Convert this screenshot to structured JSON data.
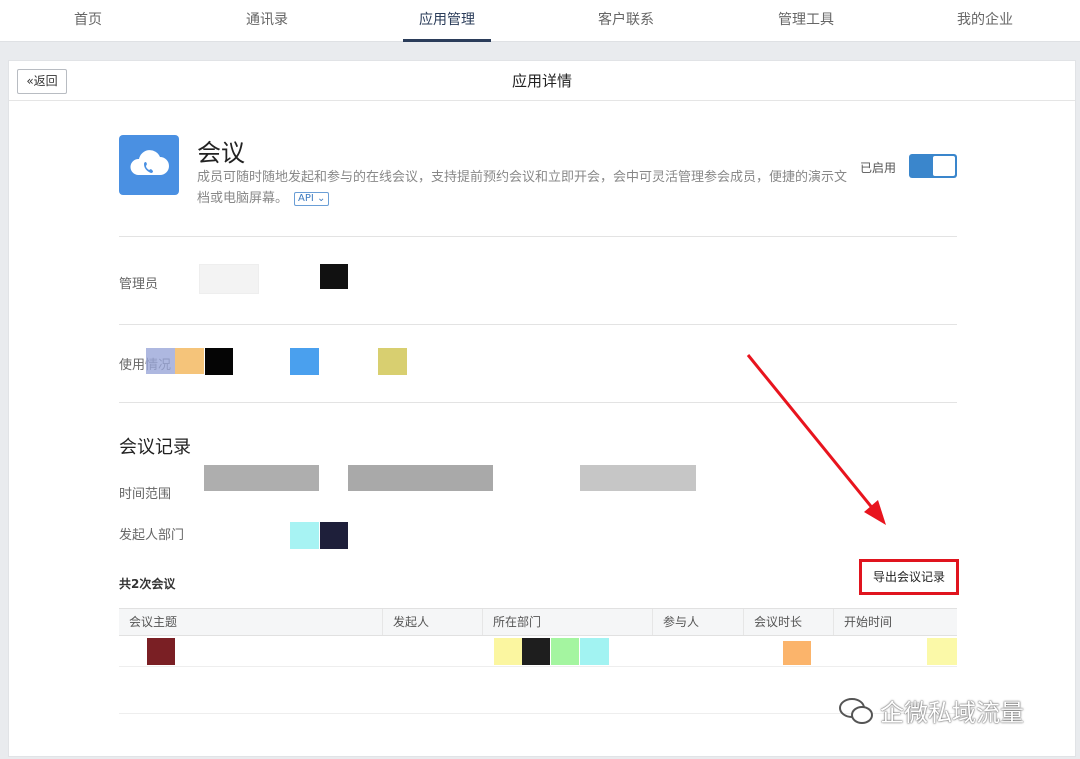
{
  "nav": {
    "tabs": [
      "首页",
      "通讯录",
      "应用管理",
      "客户联系",
      "管理工具",
      "我的企业"
    ],
    "active_index": 2
  },
  "header": {
    "back_label": "«返回",
    "title": "应用详情"
  },
  "app": {
    "name": "会议",
    "description": "成员可随时随地发起和参与的在线会议，支持提前预约会议和立即开会，会中可灵活管理参会成员，便捷的演示文档或电脑屏幕。",
    "api_badge": "API ⌄",
    "status_label": "已启用",
    "toggle_on": true,
    "icon": "cloud-phone-icon",
    "icon_color": "#4a90e2"
  },
  "fields": {
    "admin_label": "管理员",
    "usage_label": "使用情况",
    "time_range_label": "时间范围",
    "dept_label": "发起人部门"
  },
  "records": {
    "section_title": "会议记录",
    "count_text": "共2次会议",
    "export_label": "导出会议记录",
    "columns": [
      "会议主题",
      "发起人",
      "所在部门",
      "参与人",
      "会议时长",
      "开始时间"
    ]
  },
  "watermark": "企微私域流量",
  "colors": {
    "accent": "#3a86cc",
    "highlight_border": "#e0141e",
    "arrow": "#e8141e"
  }
}
